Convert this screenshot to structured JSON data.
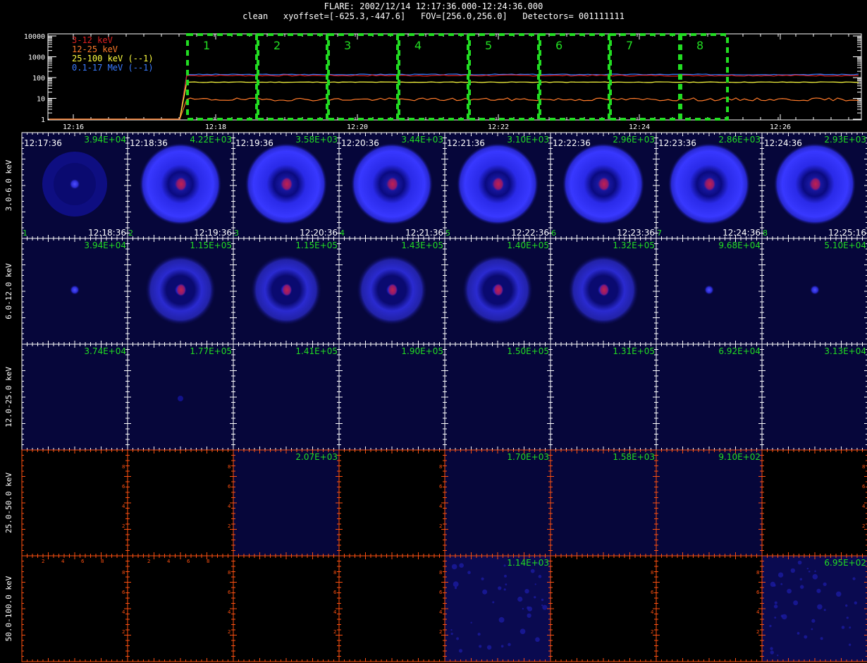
{
  "header": {
    "line1": "FLARE: 2002/12/14 12:17:36.000-12:24:36.000",
    "line2": "clean   xyoffset=[-625.3,-447.6]   FOV=[256.0,256.0]   Detectors= 001111111"
  },
  "lightcurve": {
    "yticks": [
      "10000",
      "1000",
      "100",
      "10",
      "1"
    ],
    "xticks": [
      "12:16",
      "12:18",
      "12:20",
      "12:22",
      "12:24",
      "12:26"
    ],
    "legend": [
      {
        "label": "3-12 keV",
        "color": "#e02020"
      },
      {
        "label": "12-25 keV",
        "color": "#ff7a2a"
      },
      {
        "label": "25-100 keV (--1)",
        "color": "#ffff40"
      },
      {
        "label": "0.1-17 MeV (--1)",
        "color": "#3a7bff"
      }
    ],
    "intervals": [
      "1",
      "2",
      "3",
      "4",
      "5",
      "6",
      "7",
      "8"
    ],
    "interval_color": "#22dd22"
  },
  "rows": [
    {
      "label": "3.0-6.0 keV",
      "frame_color": "#ffffff",
      "maxvals": [
        "3.94E+04",
        "4.22E+03",
        "3.58E+03",
        "3.44E+03",
        "3.10E+03",
        "2.96E+03",
        "2.86E+03",
        "2.93E+03"
      ],
      "start_times": [
        "12:17:36",
        "12:18:36",
        "12:19:36",
        "12:20:36",
        "12:21:36",
        "12:22:36",
        "12:23:36",
        "12:24:36"
      ],
      "end_times": [
        "12:18:36",
        "12:19:36",
        "12:20:36",
        "12:21:36",
        "12:22:36",
        "12:23:36",
        "12:24:36",
        "12:25:16"
      ],
      "indices": [
        "1",
        "2",
        "3",
        "4",
        "5",
        "6",
        "7",
        "8"
      ],
      "kind": [
        "sparse",
        "ring",
        "ring",
        "ring",
        "ring",
        "ring",
        "ring",
        "ring"
      ]
    },
    {
      "label": "6.0-12.0 keV",
      "frame_color": "#ffffff",
      "maxvals": [
        "3.94E+04",
        "1.15E+05",
        "1.15E+05",
        "1.43E+05",
        "1.40E+05",
        "1.32E+05",
        "9.68E+04",
        "5.10E+04"
      ],
      "kind": [
        "dot",
        "ringdim",
        "ringdim",
        "ringdim",
        "ringdim",
        "ringdim",
        "dot",
        "dot"
      ]
    },
    {
      "label": "12.0-25.0 keV",
      "frame_color": "#ffffff",
      "maxvals": [
        "3.74E+04",
        "1.77E+05",
        "1.41E+05",
        "1.90E+05",
        "1.50E+05",
        "1.31E+05",
        "6.92E+04",
        "3.13E+04"
      ],
      "kind": [
        "plain",
        "tiny",
        "plain",
        "plain",
        "plain",
        "plain",
        "plain",
        "plain"
      ]
    },
    {
      "label": "25.0-50.0 keV",
      "frame_color": "#ff5010",
      "maxvals": [
        "",
        "",
        "2.07E+03",
        "",
        "1.70E+03",
        "1.58E+03",
        "9.10E+02",
        ""
      ],
      "kind": [
        "empty",
        "empty",
        "plain",
        "empty",
        "plain",
        "plain",
        "plain",
        "empty"
      ]
    },
    {
      "label": "50.0-100.0 keV",
      "frame_color": "#ff5010",
      "maxvals": [
        "",
        "",
        "",
        "",
        "1.14E+03",
        "",
        "",
        "6.95E+02"
      ],
      "kind": [
        "emptyx",
        "emptyx",
        "empty",
        "empty",
        "noise",
        "empty",
        "empty",
        "noise"
      ]
    }
  ]
}
